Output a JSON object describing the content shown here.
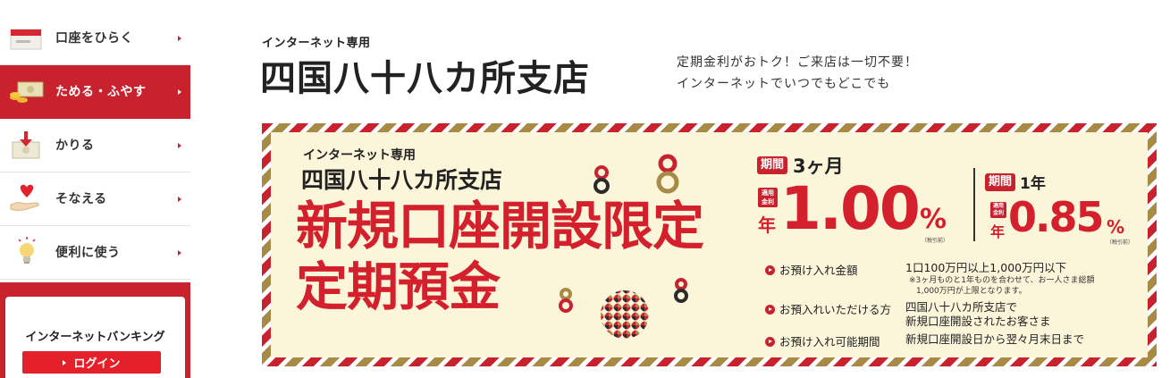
{
  "sidebar": {
    "items": [
      {
        "label": "口座をひらく",
        "icon": "bankbook-icon",
        "active": false
      },
      {
        "label": "ためる・ふやす",
        "icon": "money-stack-icon",
        "active": true
      },
      {
        "label": "かりる",
        "icon": "borrow-arrow-icon",
        "active": false
      },
      {
        "label": "そなえる",
        "icon": "heart-hand-icon",
        "active": false
      },
      {
        "label": "便利に使う",
        "icon": "lightbulb-icon",
        "active": false
      }
    ],
    "internet_banking": {
      "title": "インターネットバンキング",
      "login_label": "ログイン"
    }
  },
  "header": {
    "label": "インターネット専用",
    "branch_name": "四国八十八カ所支店",
    "tagline": [
      "定期金利がおトク！ご来店は一切不要！",
      "インターネットでいつでもどこでも"
    ]
  },
  "banner": {
    "sub_label": "インターネット専用",
    "branch_name": "四国八十八カ所支店",
    "headline_line1": "新規口座開設限定",
    "headline_line2": "定期預金",
    "plan1": {
      "badge": "期間",
      "term": "3ヶ月",
      "rate_badge_top": "適用",
      "rate_badge_bottom": "金利",
      "year_label": "年",
      "rate": "1.00",
      "unit": "%",
      "tax_note": "（税引前）"
    },
    "plan2": {
      "badge": "期間",
      "term": "1年",
      "rate_badge_top": "適用",
      "rate_badge_bottom": "金利",
      "year_label": "年",
      "rate": "0.85",
      "unit": "%",
      "tax_note": "（税引前）"
    },
    "info": [
      {
        "label": "お預け入れ金額",
        "value": "1口100万円以上1,000万円以下",
        "note": [
          "※3ヶ月ものと1年ものを合わせて、お一人さま総額",
          "1,000万円が上限となります。"
        ]
      },
      {
        "label": "お預入れいただける方",
        "value": "四国八十八カ所支店で",
        "value2": "新規口座開設されたお客さま"
      },
      {
        "label": "お預け入れ可能期間",
        "value": "新規口座開設日から翌々月末日まで"
      }
    ]
  },
  "colors": {
    "brand_red": "#c8222f",
    "headline_red": "#d3202c",
    "gold": "#a88a47",
    "banner_bg": "#fbf5d9"
  }
}
